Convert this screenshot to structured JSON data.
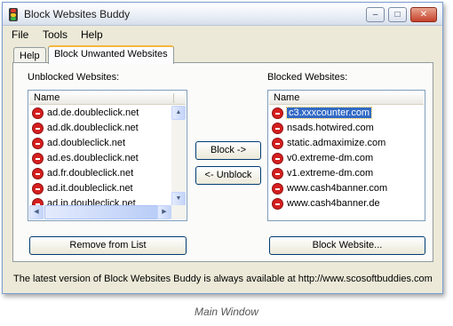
{
  "window": {
    "title": "Block Websites Buddy"
  },
  "title_buttons": {
    "minimize": "–",
    "maximize": "□",
    "close": "✕"
  },
  "menu": [
    "File",
    "Tools",
    "Help"
  ],
  "tabs": [
    "Help",
    "Block Unwanted Websites"
  ],
  "unblocked": {
    "label": "Unblocked Websites:",
    "column": "Name",
    "items": [
      "ad.de.doubleclick.net",
      "ad.dk.doubleclick.net",
      "ad.doubleclick.net",
      "ad.es.doubleclick.net",
      "ad.fr.doubleclick.net",
      "ad.it.doubleclick.net",
      "ad.jp.doubleclick.net"
    ],
    "remove_button": "Remove from List"
  },
  "blocked": {
    "label": "Blocked Websites:",
    "column": "Name",
    "items": [
      "c3.xxxcounter.com",
      "nsads.hotwired.com",
      "static.admaximize.com",
      "v0.extreme-dm.com",
      "v1.extreme-dm.com",
      "www.cash4banner.com",
      "www.cash4banner.de"
    ],
    "selected_index": 0,
    "block_button": "Block Website..."
  },
  "actions": {
    "block": "Block ->",
    "unblock": "<- Unblock"
  },
  "status": "The latest version of Block Websites Buddy is always available at http://www.scosoftbuddies.com",
  "caption": "Main Window",
  "colors": {
    "selection": "#316ac5",
    "blocked_icon": "#d41f1f"
  },
  "icons": {
    "app": "traffic-light-icon",
    "site": "blocked-site-icon"
  }
}
